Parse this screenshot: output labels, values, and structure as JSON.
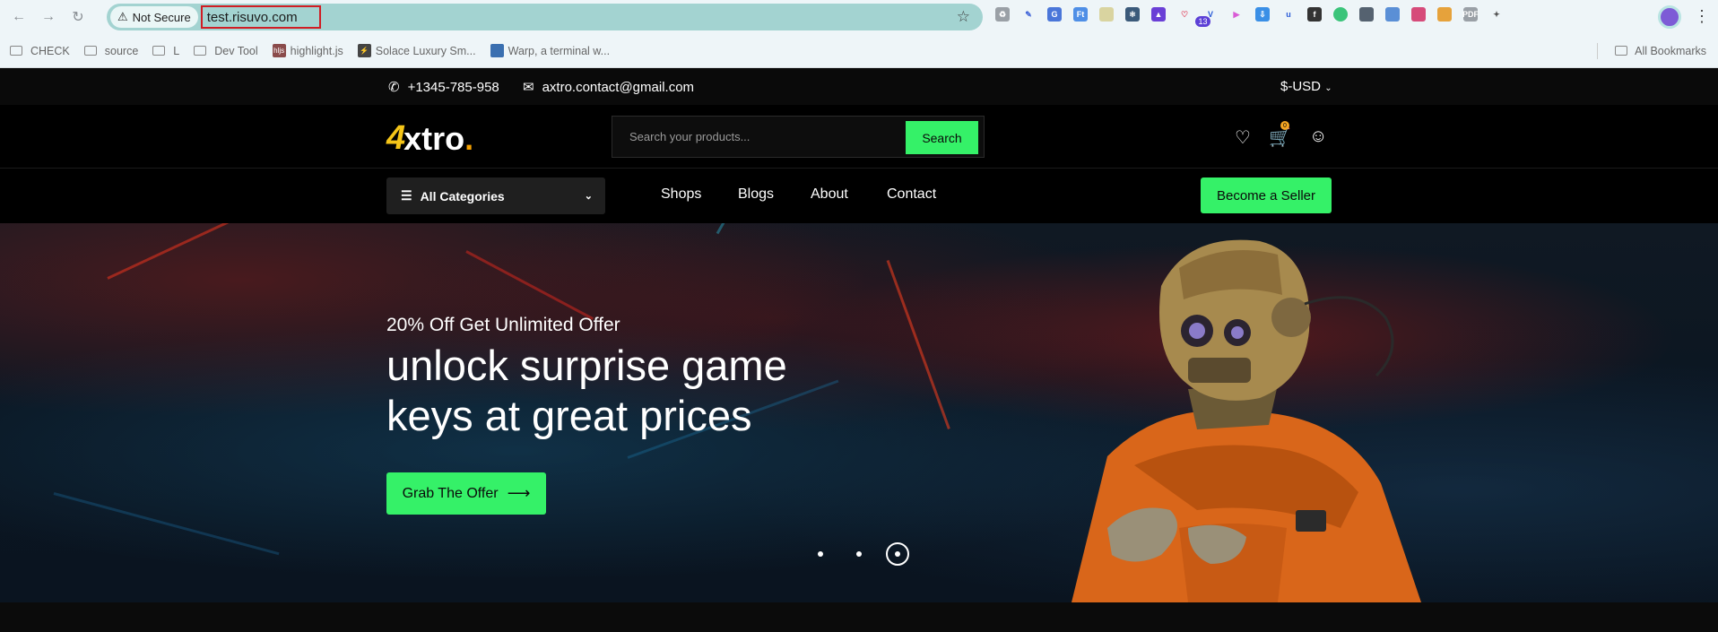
{
  "browser": {
    "security_label": "Not Secure",
    "url": "test.risuvo.com",
    "extension_badge": "13",
    "bookmarks": [
      {
        "label": "CHECK",
        "kind": "folder"
      },
      {
        "label": "source",
        "kind": "folder"
      },
      {
        "label": "L",
        "kind": "folder"
      },
      {
        "label": "Dev Tool",
        "kind": "folder"
      },
      {
        "label": "highlight.js",
        "kind": "site"
      },
      {
        "label": "Solace Luxury Sm...",
        "kind": "site"
      },
      {
        "label": "Warp, a terminal w...",
        "kind": "site"
      }
    ],
    "all_bookmarks": "All Bookmarks"
  },
  "topbar": {
    "phone": "+1345-785-958",
    "email": "axtro.contact@gmail.com",
    "currency": "$-USD"
  },
  "header": {
    "logo_text": "xtro",
    "logo_dot": ".",
    "search_placeholder": "Search your products...",
    "search_button": "Search",
    "cart_count": "0"
  },
  "nav": {
    "categories_label": "All Categories",
    "links": [
      "Shops",
      "Blogs",
      "About",
      "Contact"
    ],
    "seller_button": "Become a Seller"
  },
  "hero": {
    "subtitle": "20% Off Get Unlimited Offer",
    "title": "unlock surprise game keys at great prices",
    "cta": "Grab The Offer",
    "slides": 3,
    "active_slide": 3
  },
  "colors": {
    "accent_green": "#35f168",
    "logo_yellow": "#f5c518",
    "url_highlight_border": "#d01d24"
  }
}
